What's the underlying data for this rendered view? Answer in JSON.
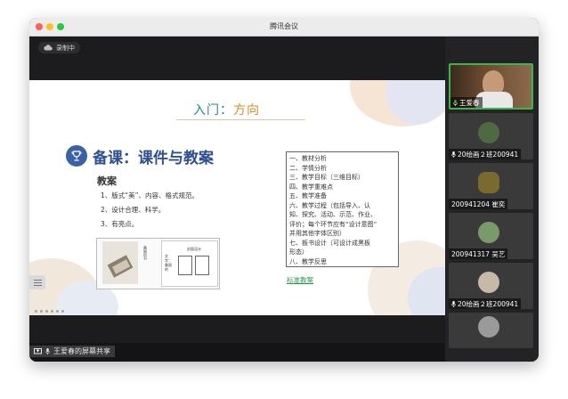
{
  "window": {
    "title": "腾讯会议"
  },
  "main": {
    "recording_label": "录制中",
    "slide": {
      "title_prefix": "入门：",
      "title_accent": "方向",
      "heading": "备课：课件与教案",
      "subheading": "教案",
      "points": [
        "1、版式“美”、内容、格式规范。",
        "2、设计合理、科学。",
        "3、有亮点。"
      ],
      "thumb_lines": [
        "美丽的书",
        "文字：美丽的",
        "封面设计"
      ],
      "list": [
        "一、教材分析",
        "二、学情分析",
        "三、教学目标（三维目标）",
        "四、教学重难点",
        "五、教学准备",
        "六、教学过程（包括导入、认",
        "知、探究、活动、示范、作业、",
        "评价；每个环节应有“设计意图”",
        "并用其他字体区别）",
        "七、板书设计（可设计成黑板",
        "形态）",
        "八、教学反思"
      ],
      "link": "标准教案"
    }
  },
  "bottom": {
    "share_label": "王爱春的屏幕共享"
  },
  "participants": [
    {
      "name": "王爱春",
      "active": true,
      "color": "#5a4030"
    },
    {
      "name": "20绘画２班200941",
      "active": false,
      "color": "#3a4a3a"
    },
    {
      "name": "200941204 崔奕",
      "active": false,
      "color": "#2d2d2d"
    },
    {
      "name": "200941317 吴艺",
      "active": false,
      "color": "#3a3a3a"
    },
    {
      "name": "20绘画２班200941",
      "active": false,
      "color": "#3a3a3a"
    }
  ],
  "colors": {
    "active_border": "#3fb34f",
    "slide_accent": "#2f4f8f",
    "link": "#2b9a4f"
  },
  "icons": {
    "record": "cloud-icon",
    "share": "screen-share-icon",
    "mic": "microphone-icon",
    "heading": "trophy-icon"
  }
}
